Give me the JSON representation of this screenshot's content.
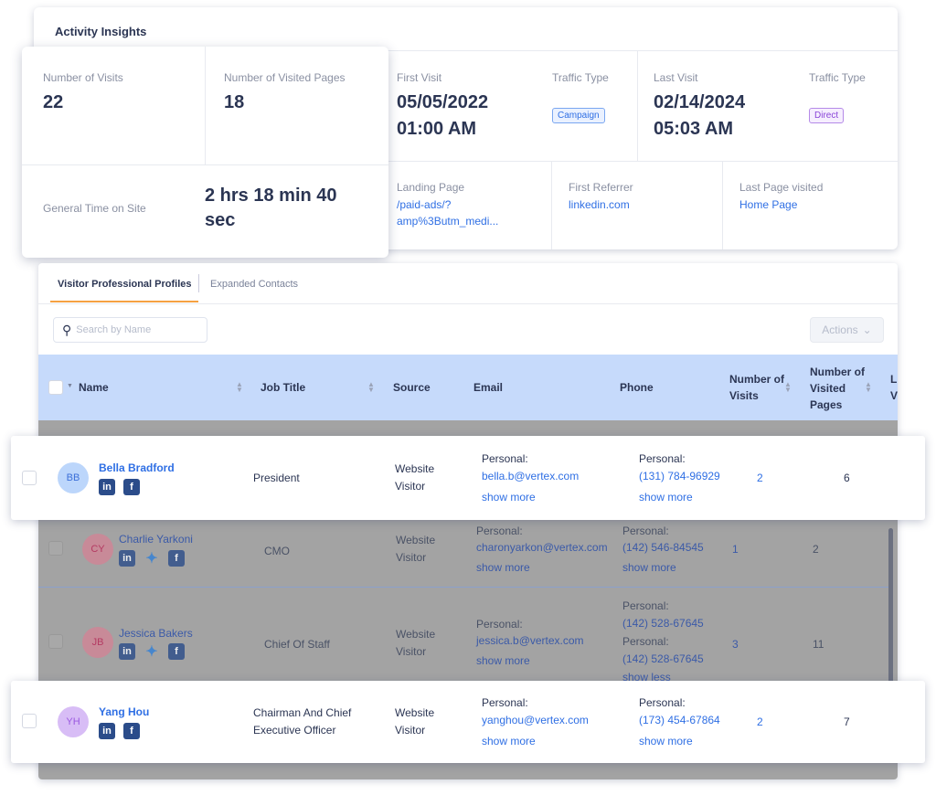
{
  "activity": {
    "title": "Activity Insights",
    "visits_label": "Number of Visits",
    "visits": "22",
    "pages_label": "Number of Visited Pages",
    "pages": "18",
    "time_label": "General Time on Site",
    "time": "2 hrs 18 min 40 sec",
    "first_visit_label": "First Visit",
    "first_visit_date": "05/05/2022",
    "first_visit_time": "01:00 AM",
    "traffic_label_1": "Traffic Type",
    "traffic_1": "Campaign",
    "last_visit_label": "Last Visit",
    "last_visit_date": "02/14/2024",
    "last_visit_time": "05:03 AM",
    "traffic_label_2": "Traffic Type",
    "traffic_2": "Direct",
    "landing_label": "Landing Page",
    "landing_1": "/paid-ads/?",
    "landing_2": "amp%3Butm_medi...",
    "referrer_label": "First Referrer",
    "referrer": "linkedin.com",
    "last_page_label": "Last Page visited",
    "last_page": "Home Page"
  },
  "tabs": [
    {
      "label": "Visitor Professional Profiles",
      "active": true
    },
    {
      "label": "Expanded Contacts"
    }
  ],
  "search": {
    "placeholder": "Search by Name"
  },
  "actions_label": "Actions",
  "columns": [
    "Name",
    "Job Title",
    "Source",
    "Email",
    "Phone",
    "Number of Visits",
    "Number of Visited Pages",
    "L V"
  ],
  "rows": [
    {
      "initials": "BB",
      "name": "Bella Bradford",
      "title": "President",
      "source": "Website Visitor",
      "email_label": "Personal:",
      "email": "bella.b@vertex.com",
      "email_more": "show more",
      "phone_label": "Personal:",
      "phone": "(131) 784-96929",
      "phone_more": "show more",
      "visits": "2",
      "pages": "6",
      "social": [
        "linkedin",
        "facebook"
      ]
    },
    {
      "initials": "CY",
      "name": "Charlie Yarkoni",
      "title": "CMO",
      "source": "Website Visitor",
      "email_label": "Personal:",
      "email": "charonyarkon@vertex.com",
      "email_more": "show more",
      "phone_label": "Personal:",
      "phone": "(142) 546-84545",
      "phone_more": "show more",
      "visits": "1",
      "pages": "2",
      "social": [
        "linkedin",
        "twitter",
        "facebook"
      ]
    },
    {
      "initials": "JB",
      "name": "Jessica Bakers",
      "title": "Chief Of Staff",
      "source": "Website Visitor",
      "email_label": "Personal:",
      "email": "jessica.b@vertex.com",
      "email_more": "show more",
      "phone_label": "Personal:",
      "phone": "(142) 528-67645",
      "phone_label_2": "Personal:",
      "phone_2": "(142) 528-67645",
      "phone_more": "show less",
      "visits": "3",
      "pages": "11",
      "social": [
        "linkedin",
        "twitter",
        "facebook"
      ]
    },
    {
      "initials": "YH",
      "name": "Yang Hou",
      "title": "Chairman And Chief Executive Officer",
      "source": "Website Visitor",
      "email_label": "Personal:",
      "email": "yanghou@vertex.com",
      "email_more": "show more",
      "phone_label": "Personal:",
      "phone": "(173) 454-67864",
      "phone_more": "show more",
      "visits": "2",
      "pages": "7",
      "social": [
        "linkedin",
        "facebook"
      ]
    }
  ],
  "colors": {
    "accent": "#2f6fe4",
    "tab_underline": "#f5a142",
    "header_bg": "#c6dafb",
    "overlay": "#a3a3a3"
  }
}
